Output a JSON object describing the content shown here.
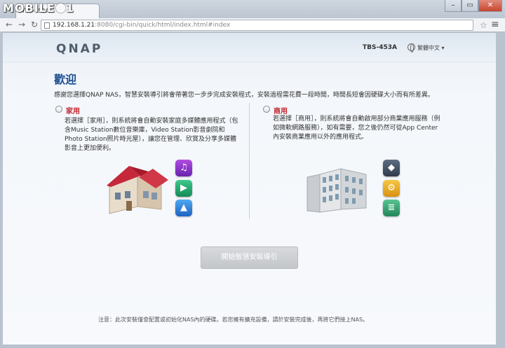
{
  "watermark": "MOBILE01",
  "browser": {
    "tab_title": "TBS-453A",
    "url_host": "192.168.1.21",
    "url_rest": ":8080/cgi-bin/quick/html/index.html#index",
    "icons": [
      "back-icon",
      "forward-icon",
      "reload-icon",
      "page-icon",
      "star-icon",
      "menu-icon"
    ]
  },
  "header": {
    "logo": "QNAP",
    "model": "TBS-453A",
    "language": "繁體中文"
  },
  "main": {
    "title": "歡迎",
    "intro": "感謝您選擇QNAP NAS，智慧安裝導引將會帶著您一步步完成安裝程式，安裝過程需花費一段時間，時間長短會因硬碟大小而有所差異。",
    "home": {
      "label": "家用",
      "description": "若選擇［家用］，則系統將會自動安裝家庭多媒體應用程式（包含Music Station數位音樂庫，Video Station影音劇院和Photo Station照片時光屋），讓您在管理、欣賞及分享多媒體影音上更加便利。"
    },
    "business": {
      "label": "商用",
      "description": "若選擇［商用］，則系統將會自動啟用部分商業應用服務（例如微軟網路服務），如有需要，您之後仍然可從App Center內安裝商業應用以外的應用程式。"
    },
    "start_button": "開始智慧安裝導引",
    "note": "注意：此次安裝僅會配置或初始化NAS內的硬碟。若您擁有擴充設備，請於安裝完成後，再將它們接上NAS。"
  },
  "colors": {
    "accent": "#1f4f8f",
    "option_label": "#c2262e",
    "button_disabled": "#c9ccd0"
  }
}
